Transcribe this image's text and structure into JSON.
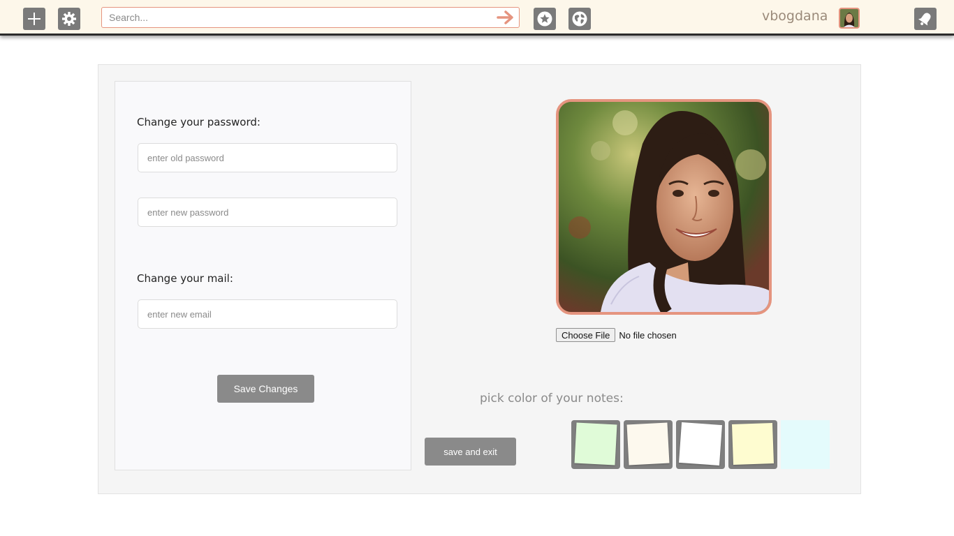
{
  "topbar": {
    "add_icon": "plus-icon",
    "settings_icon": "gear-icon",
    "search": {
      "placeholder": "Search...",
      "submit_icon": "arrow-right-icon"
    },
    "favorites_icon": "star-icon",
    "globe_icon": "globe-icon",
    "username": "vbogdana",
    "notifications_icon": "bell-icon"
  },
  "settings": {
    "password": {
      "label": "Change your password:",
      "old_placeholder": "enter old password",
      "new_placeholder": "enter new password"
    },
    "mail": {
      "label": "Change your mail:",
      "email_placeholder": "enter new email"
    },
    "save_button": "Save Changes"
  },
  "profile": {
    "file_button": "Choose File",
    "file_status": "No file chosen"
  },
  "notes": {
    "label": "pick color of your notes:",
    "save_exit_button": "save and exit",
    "swatches": [
      {
        "color": "#e0fbd8",
        "selected": true
      },
      {
        "color": "#fdf9ee",
        "selected": true
      },
      {
        "color": "#ffffff",
        "selected": true
      },
      {
        "color": "#fefcd0",
        "selected": true
      },
      {
        "color": "#e4fbfc",
        "selected": false
      }
    ]
  },
  "colors": {
    "accent": "#e5947f",
    "button_grey": "#8a8a8a",
    "topbar_bg": "#fdf7ea"
  }
}
